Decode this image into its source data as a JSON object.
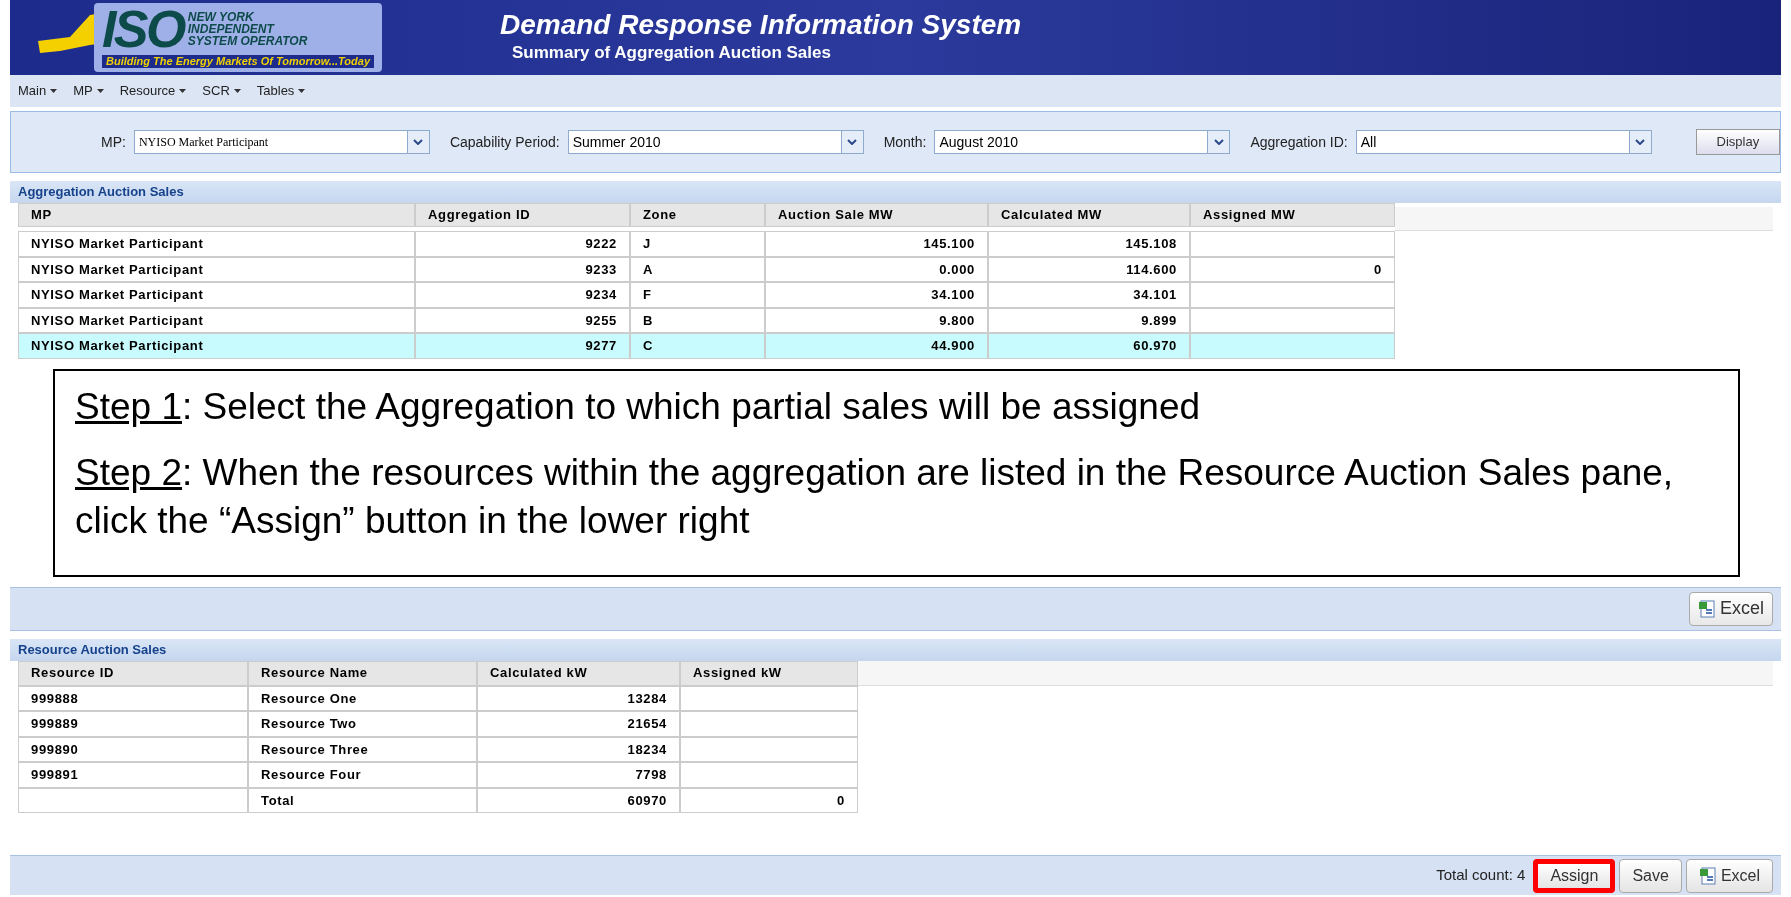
{
  "header": {
    "logo_letters": "ISO",
    "logo_lines": [
      "NEW YORK",
      "INDEPENDENT",
      "SYSTEM OPERATOR"
    ],
    "tagline": "Building The Energy Markets Of Tomorrow...Today",
    "title": "Demand Response Information System",
    "subtitle": "Summary of Aggregation Auction Sales"
  },
  "menu": [
    "Main",
    "MP",
    "Resource",
    "SCR",
    "Tables"
  ],
  "filters": [
    {
      "label": "MP:",
      "value": "NYISO Market Participant",
      "kind": "serif"
    },
    {
      "label": "Capability Period:",
      "value": "Summer 2010",
      "kind": "plain"
    },
    {
      "label": "Month:",
      "value": "August 2010",
      "kind": "plain"
    },
    {
      "label": "Aggregation ID:",
      "value": "All",
      "kind": "plain"
    }
  ],
  "display_button": "Display",
  "aggregation": {
    "title": "Aggregation Auction Sales",
    "columns": [
      "MP",
      "Aggregation ID",
      "Zone",
      "Auction Sale MW",
      "Calculated MW",
      "Assigned MW"
    ],
    "rows": [
      {
        "cells": [
          "NYISO Market Participant",
          "9222",
          "J",
          "145.100",
          "145.108",
          ""
        ],
        "selected": false
      },
      {
        "cells": [
          "NYISO Market Participant",
          "9233",
          "A",
          "0.000",
          "114.600",
          "0"
        ],
        "selected": false
      },
      {
        "cells": [
          "NYISO Market Participant",
          "9234",
          "F",
          "34.100",
          "34.101",
          ""
        ],
        "selected": false
      },
      {
        "cells": [
          "NYISO Market Participant",
          "9255",
          "B",
          "9.800",
          "9.899",
          ""
        ],
        "selected": false
      },
      {
        "cells": [
          "NYISO Market Participant",
          "9277",
          "C",
          "44.900",
          "60.970",
          ""
        ],
        "selected": true
      }
    ]
  },
  "callout": [
    {
      "step": "Step 1",
      "text": ": Select the Aggregation to which partial sales will be assigned"
    },
    {
      "step": "Step 2",
      "text": ": When the resources within the aggregation are listed in the Resource Auction Sales pane, click the “Assign” button in the lower right"
    }
  ],
  "excel_button": "Excel",
  "resources": {
    "title": "Resource Auction Sales",
    "columns": [
      "Resource ID",
      "Resource Name",
      "Calculated kW",
      "Assigned kW"
    ],
    "rows": [
      [
        "999888",
        "Resource One",
        "13284",
        ""
      ],
      [
        "999889",
        "Resource Two",
        "21654",
        ""
      ],
      [
        "999890",
        "Resource Three",
        "18234",
        ""
      ],
      [
        "999891",
        "Resource Four",
        "7798",
        ""
      ],
      [
        "",
        "Total",
        "60970",
        "0"
      ]
    ]
  },
  "footer": {
    "total_count": "Total count: 4",
    "buttons": [
      {
        "label": "Assign",
        "highlighted": true,
        "kind": "text"
      },
      {
        "label": "Save",
        "highlighted": false,
        "kind": "text"
      },
      {
        "label": "Excel",
        "highlighted": false,
        "kind": "excel"
      }
    ]
  }
}
